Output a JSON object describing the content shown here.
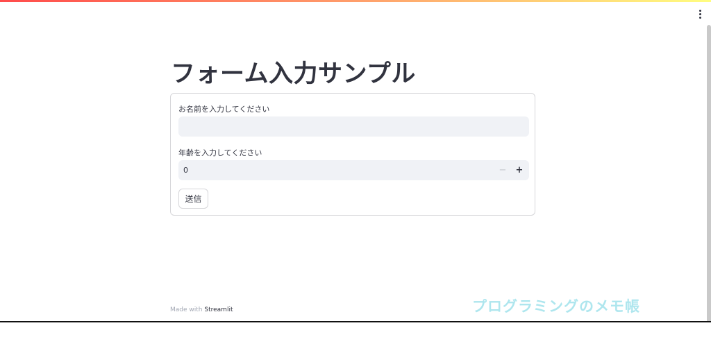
{
  "colors": {
    "accent_gradient": [
      "#ff4b4b",
      "#ff9e6b",
      "#fffd80"
    ],
    "text": "#31333f",
    "input_bg": "#f0f2f6",
    "border": "#d6d6d9",
    "watermark": "#aee6ee"
  },
  "header": {
    "menu_icon": "kebab-menu-icon"
  },
  "main": {
    "title": "フォーム入力サンプル",
    "form": {
      "name_field": {
        "label": "お名前を入力してください",
        "value": "",
        "placeholder": ""
      },
      "age_field": {
        "label": "年齢を入力してください",
        "value": "0",
        "minus_label": "−",
        "plus_label": "+"
      },
      "submit_label": "送信"
    }
  },
  "footer": {
    "prefix": "Made with",
    "brand": "Streamlit"
  },
  "watermark": "プログラミングのメモ帳"
}
